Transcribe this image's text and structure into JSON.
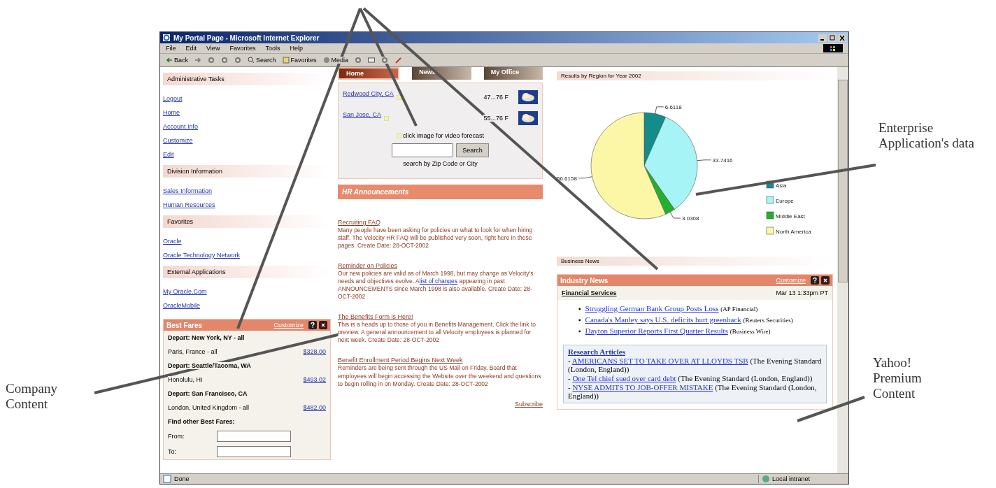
{
  "window": {
    "title": "My Portal Page - Microsoft Internet Explorer"
  },
  "menu": [
    "File",
    "Edit",
    "View",
    "Favorites",
    "Tools",
    "Help"
  ],
  "toolbar": [
    {
      "kind": "back",
      "label": "Back"
    },
    {
      "kind": "forward"
    },
    {
      "kind": "stop"
    },
    {
      "kind": "refresh"
    },
    {
      "kind": "home"
    },
    {
      "kind": "search",
      "label": "Search"
    },
    {
      "kind": "favorites",
      "label": "Favorites"
    },
    {
      "kind": "media",
      "label": "Media"
    },
    {
      "kind": "history"
    },
    {
      "kind": "mail"
    },
    {
      "kind": "print"
    },
    {
      "kind": "edit"
    }
  ],
  "nav_tabs": [
    {
      "label": "Home",
      "selected": true
    },
    {
      "label": "News",
      "selected": false
    },
    {
      "label": "My Office",
      "selected": false
    }
  ],
  "sidebar": [
    {
      "title": "Administrative Tasks",
      "links": [
        "Logout",
        "Home",
        "Account Info",
        "Customize",
        "Edit"
      ]
    },
    {
      "title": "Division Information",
      "links": [
        "Sales Information",
        "Human Resources"
      ]
    },
    {
      "title": "Favorites",
      "links": [
        "Oracle",
        "Oracle Technology Network"
      ]
    },
    {
      "title": "External Applications",
      "links": [
        "My Oracle.Com",
        "OracleMobile"
      ]
    }
  ],
  "best_fares": {
    "title": "Best Fares",
    "customize": "Customize",
    "groups": [
      {
        "depart": "Depart: New York, NY - all",
        "destination": "Paris, France - all",
        "price": "$328.00"
      },
      {
        "depart": "Depart: Seattle/Tacoma, WA",
        "destination": "Honolulu, HI",
        "price": "$493.02"
      },
      {
        "depart": "Depart: San Francisco, CA",
        "destination": "London, United Kingdom - all",
        "price": "$482.00"
      }
    ],
    "find": "Find other Best Fares:",
    "from": "From:",
    "to": "To:"
  },
  "weather": {
    "rows": [
      {
        "city": "Redwood City, CA",
        "temp": "47...76 F"
      },
      {
        "city": "San Jose, CA",
        "temp": "55...76 F"
      }
    ],
    "note": "click image for video forecast",
    "button": "Search",
    "hint": "search by Zip Code or City"
  },
  "hr": {
    "title": "HR Announcements",
    "items": [
      {
        "title": "Recruiting FAQ",
        "body": "Many people have been asking for policies on what to look for when hiring staff. The Velocity HR FAQ will be published very soon, right here in these pages. Create Date: 28-OCT-2002"
      },
      {
        "title": "Reminder on Policies",
        "body": "Our new policies are valid as of March 1998, but may change as Velocity's needs and objectives evolve. A",
        "link": "list of changes",
        "after": "appearing in past ANNOUNCEMENTS since March 1998 is also available. Create Date: 28-OCT-2002"
      },
      {
        "title": "The Benefits Form is Here!",
        "body": "This is a heads up to those of you in Benefits Management. Click the link to preview. A general announcement to all Velocity employees is planned for next week. Create Date: 28-OCT-2002"
      },
      {
        "title": "Benefit Enrollment Period Begins Next Week",
        "body": "Reminders are being sent through the US Mail on Friday. Board that employees will begin accessing the Website over the weekend and questions to begin rolling in on Monday. Create Date: 28-OCT-2002"
      }
    ],
    "subscribe": "Subscribe"
  },
  "results": {
    "title": "Results by Region for Year 2002",
    "chart_data": {
      "type": "pie",
      "categories": [
        "Asia",
        "Europe",
        "Middle East",
        "North America"
      ],
      "values": [
        6.6118,
        33.7416,
        3.0308,
        56.6158
      ],
      "colors": [
        "#138c8c",
        "#a6f4f6",
        "#22b02e",
        "#fbf7a6"
      ],
      "data_labels": true,
      "legend": "right"
    }
  },
  "business_news": "Business News",
  "industry_news": {
    "title": "Industry News",
    "customize": "Customize",
    "category": "Financial Services",
    "date": "Mar 13 1:33pm PT",
    "items": [
      {
        "marker": "▪",
        "link": "Struggling German Bank Group Posts Loss",
        "source": "(AP Financial)"
      },
      {
        "marker": "▪",
        "link": "Canada's Manley says U.S. deficits hurt greenback",
        "source": "(Reuters Securities)"
      },
      {
        "marker": "▪",
        "link": "Dayton Superior Reports First Quarter Results",
        "source": "(Business Wire)"
      }
    ]
  },
  "research": {
    "title": "Research Articles",
    "items": [
      {
        "dash": "-",
        "link": "AMERICANS SET TO TAKE OVER AT LLOYDS TSB",
        "source": "(The Evening Standard (London, England))"
      },
      {
        "dash": "-",
        "link": "One Tel chief sued over card debt",
        "source": "(The Evening Standard (London, England))"
      },
      {
        "dash": "-",
        "link": "NYSE ADMITS TO JOB-OFFER MISTAKE",
        "source": "(The Evening Standard (London, England))"
      }
    ]
  },
  "status_bar": {
    "text": "Done",
    "zone": "Local intranet"
  },
  "annotations": [
    {
      "kind": "left",
      "text": "Company Content"
    },
    {
      "kind": "right",
      "text": "Enterprise Application's data"
    },
    {
      "kind": "lower",
      "text": "Yahoo! Premium Content"
    }
  ]
}
